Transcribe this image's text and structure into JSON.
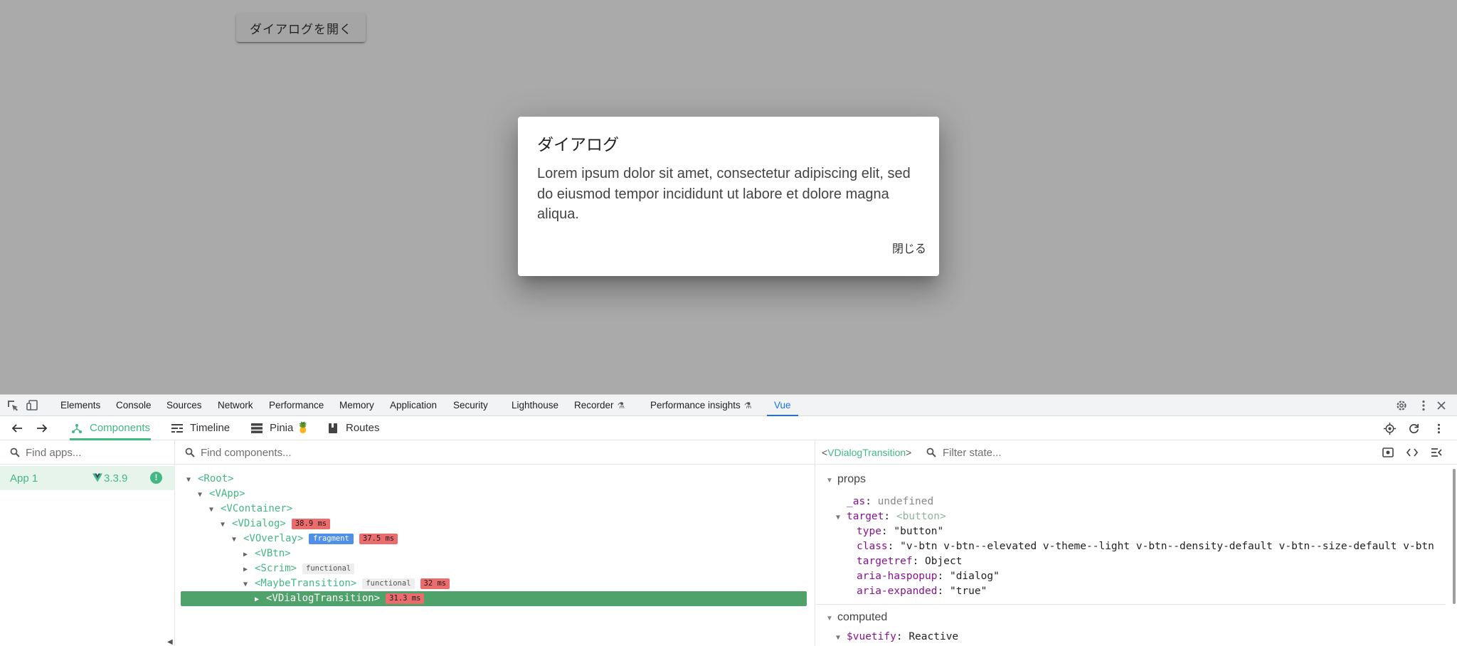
{
  "page": {
    "open_button": "ダイアログを開く",
    "dialog": {
      "title": "ダイアログ",
      "text": "Lorem ipsum dolor sit amet, consectetur adipiscing elit, sed do eiusmod tempor incididunt ut labore et dolore magna aliqua.",
      "close_label": "閉じる"
    }
  },
  "devtools": {
    "tabs": [
      {
        "label": "Elements"
      },
      {
        "label": "Console"
      },
      {
        "label": "Sources"
      },
      {
        "label": "Network"
      },
      {
        "label": "Performance"
      },
      {
        "label": "Memory"
      },
      {
        "label": "Application"
      },
      {
        "label": "Security"
      },
      {
        "label": "Lighthouse"
      },
      {
        "label": "Recorder"
      },
      {
        "label": "Performance insights"
      },
      {
        "label": "Vue"
      }
    ],
    "active_tab": "Vue",
    "icons": [
      "inspect-element-icon",
      "device-toolbar-icon",
      "settings-gear-icon",
      "more-vert-icon",
      "close-icon",
      "flask-icon"
    ]
  },
  "vue": {
    "toolbar": {
      "components": "Components",
      "timeline": "Timeline",
      "pinia": "Pinia 🍍",
      "routes": "Routes"
    },
    "apps": {
      "search_placeholder": "Find apps...",
      "app_name": "App 1",
      "vue_version": "3.3.9",
      "warning_badge": "!"
    },
    "tree": {
      "search_placeholder": "Find components...",
      "nodes": {
        "root": "<Root>",
        "vapp": "<VApp>",
        "vcontainer": "<VContainer>",
        "vdialog": "<VDialog>",
        "vdialog_time": "38.9 ms",
        "voverlay": "<VOverlay>",
        "voverlay_tag": "fragment",
        "voverlay_time": "37.5 ms",
        "vbtn": "<VBtn>",
        "scrim": "<Scrim>",
        "scrim_tag": "functional",
        "maybe": "<MaybeTransition>",
        "maybe_tag": "functional",
        "maybe_time": "32 ms",
        "vdt": "<VDialogTransition>",
        "vdt_time": "31.3 ms"
      }
    },
    "state": {
      "selected_component": "VDialogTransition",
      "filter_placeholder": "Filter state...",
      "props_title": "props",
      "as_key": "_as",
      "as_val": "undefined",
      "target_key": "target",
      "target_val": "<button>",
      "type_key": "type",
      "type_val": "\"button\"",
      "class_key": "class",
      "class_val": "\"v-btn v-btn--elevated v-theme--light v-btn--density-default v-btn--size-default v-btn",
      "targetref_key": "targetref",
      "targetref_val": "Object",
      "haspopup_key": "aria-haspopup",
      "haspopup_val": "\"dialog\"",
      "expanded_key": "aria-expanded",
      "expanded_val": "\"true\"",
      "computed_title": "computed",
      "vuetify_key": "$vuetify",
      "vuetify_val": "Reactive"
    }
  },
  "colors": {
    "vue_green": "#42b883",
    "selected_row": "#4ea26a",
    "timing_badge": "#ea6c6c",
    "fragment_badge": "#4f8fe8",
    "active_devtools_tab": "#1a73e8",
    "scrim": "#aaaaaa"
  }
}
